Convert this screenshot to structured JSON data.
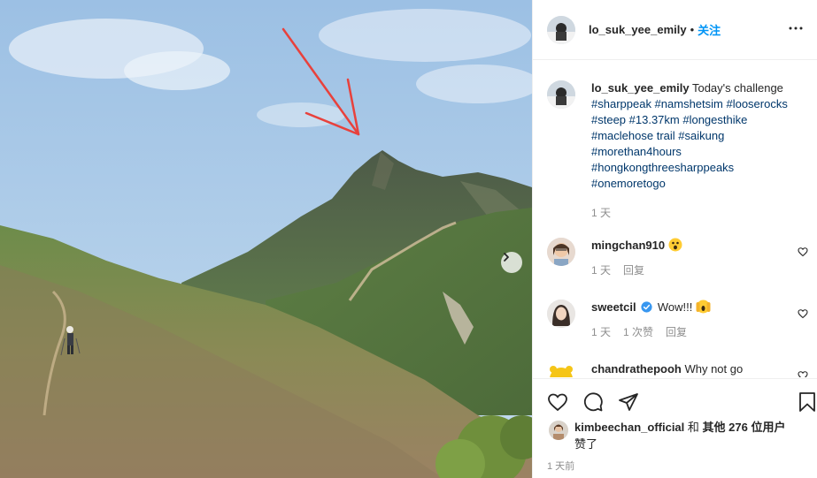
{
  "post": {
    "username": "lo_suk_yee_emily",
    "dot": "•",
    "follow_label": "关注",
    "caption_text": "Today's challenge",
    "hashtags": "#sharppeak #namshetsim #looserocks #steep #13.37km #longesthike #maclehose trail #saikung #morethan4hours #hongkongthreesharppeaks #onemoretogo",
    "caption_age": "1 天"
  },
  "comments": [
    {
      "username": "mingchan910",
      "text": "",
      "emoji": "astonished-face",
      "age": "1 天",
      "likes": "",
      "reply": "回复"
    },
    {
      "username": "sweetcil",
      "text": "Wow!!!",
      "emoji": "screaming-hands",
      "verified": true,
      "age": "1 天",
      "likes": "1 次赞",
      "reply": "回复"
    },
    {
      "username": "chandrathepooh",
      "text": "Why not go",
      "emoji": ""
    }
  ],
  "likes": {
    "user": "kimbeechan_official",
    "joiner": "和",
    "others": "其他 276 位用户",
    "suffix": "赞了"
  },
  "post_age": "1 天前",
  "colors": {
    "link": "#00376b",
    "follow": "#0095f6",
    "muted": "#8e8e8e",
    "annotation_arrow": "#e8413c"
  }
}
